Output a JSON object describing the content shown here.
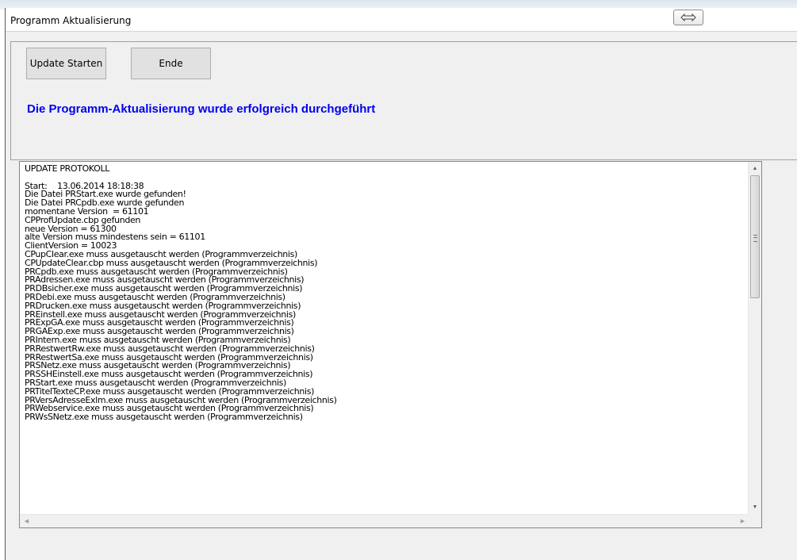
{
  "window": {
    "title": "Programm Aktualisierung"
  },
  "toolbar": {
    "update_label": "Update Starten",
    "ende_label": "Ende"
  },
  "status": {
    "message": "Die Programm-Aktualisierung wurde erfolgreich durchgeführt",
    "color": "#0000ee"
  },
  "log": {
    "lines": [
      "UPDATE PROTOKOLL",
      "",
      "Start:    13.06.2014 18:18:38",
      "Die Datei PRStart.exe wurde gefunden!",
      "Die Datei PRCpdb.exe wurde gefunden",
      "momentane Version  = 61101",
      "CPProfUpdate.cbp gefunden",
      "neue Version = 61300",
      "alte Version muss mindestens sein = 61101",
      "ClientVersion = 10023",
      "CPupClear.exe muss ausgetauscht werden (Programmverzeichnis)",
      "CPUpdateClear.cbp muss ausgetauscht werden (Programmverzeichnis)",
      "PRCpdb.exe muss ausgetauscht werden (Programmverzeichnis)",
      "PRAdressen.exe muss ausgetauscht werden (Programmverzeichnis)",
      "PRDBsicher.exe muss ausgetauscht werden (Programmverzeichnis)",
      "PRDebi.exe muss ausgetauscht werden (Programmverzeichnis)",
      "PRDrucken.exe muss ausgetauscht werden (Programmverzeichnis)",
      "PREinstell.exe muss ausgetauscht werden (Programmverzeichnis)",
      "PRExpGA.exe muss ausgetauscht werden (Programmverzeichnis)",
      "PRGAExp.exe muss ausgetauscht werden (Programmverzeichnis)",
      "PRIntern.exe muss ausgetauscht werden (Programmverzeichnis)",
      "PRRestwertRw.exe muss ausgetauscht werden (Programmverzeichnis)",
      "PRRestwertSa.exe muss ausgetauscht werden (Programmverzeichnis)",
      "PRSNetz.exe muss ausgetauscht werden (Programmverzeichnis)",
      "PRSSHEinstell.exe muss ausgetauscht werden (Programmverzeichnis)",
      "PRStart.exe muss ausgetauscht werden (Programmverzeichnis)",
      "PRTitelTexteCP.exe muss ausgetauscht werden (Programmverzeichnis)",
      "PRVersAdresseExlm.exe muss ausgetauscht werden (Programmverzeichnis)",
      "PRWebservice.exe muss ausgetauscht werden (Programmverzeichnis)",
      "PRWsSNetz.exe muss ausgetauscht werden (Programmverzeichnis)"
    ]
  },
  "icons": {
    "resize": "double-arrow-icon",
    "scroll_up": "arrow-up-icon",
    "scroll_down": "arrow-down-icon",
    "scroll_left": "arrow-left-icon",
    "scroll_right": "arrow-right-icon"
  }
}
